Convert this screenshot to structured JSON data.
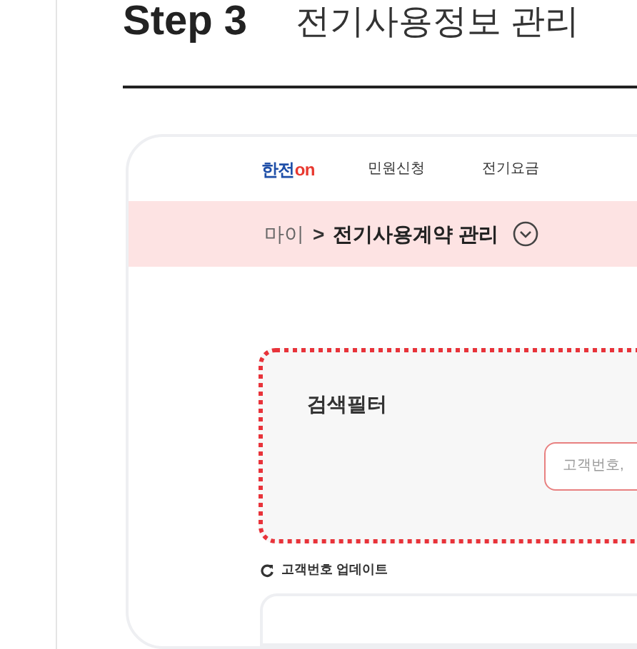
{
  "step": {
    "label": "Step 3",
    "title": "전기사용정보 관리"
  },
  "nav": {
    "logo": {
      "left": "한전",
      "right": "on"
    },
    "items": [
      "민원신청",
      "전기요금"
    ]
  },
  "breadcrumb": {
    "parent": "마이",
    "separator": ">",
    "current": "전기사용계약 관리"
  },
  "search_filter": {
    "title": "검색필터",
    "placeholder": "고객번호,"
  },
  "update_link": "고객번호 업데이트"
}
